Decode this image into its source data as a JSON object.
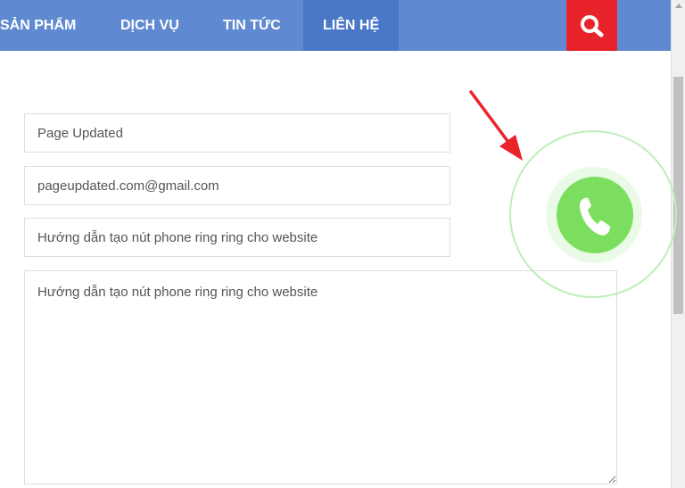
{
  "nav": {
    "items": [
      {
        "label": "SẢN PHẨM"
      },
      {
        "label": "DỊCH VỤ"
      },
      {
        "label": "TIN TỨC"
      },
      {
        "label": "LIÊN HỆ",
        "active": true
      }
    ],
    "search_icon": "search-icon"
  },
  "form": {
    "name_value": "Page Updated",
    "email_value": "pageupdated.com@gmail.com",
    "subject_value": "Hướng dẫn tạo nút phone ring ring cho website",
    "message_value": "Hướng dẫn tạo nút phone ring ring cho website"
  },
  "phone_widget": {
    "icon": "phone-icon"
  },
  "colors": {
    "nav_bg": "#5f8ad2",
    "nav_active_bg": "#4a78c8",
    "search_bg": "#e8232a",
    "phone_green": "#7cde5e",
    "arrow_red": "#e8232a"
  }
}
